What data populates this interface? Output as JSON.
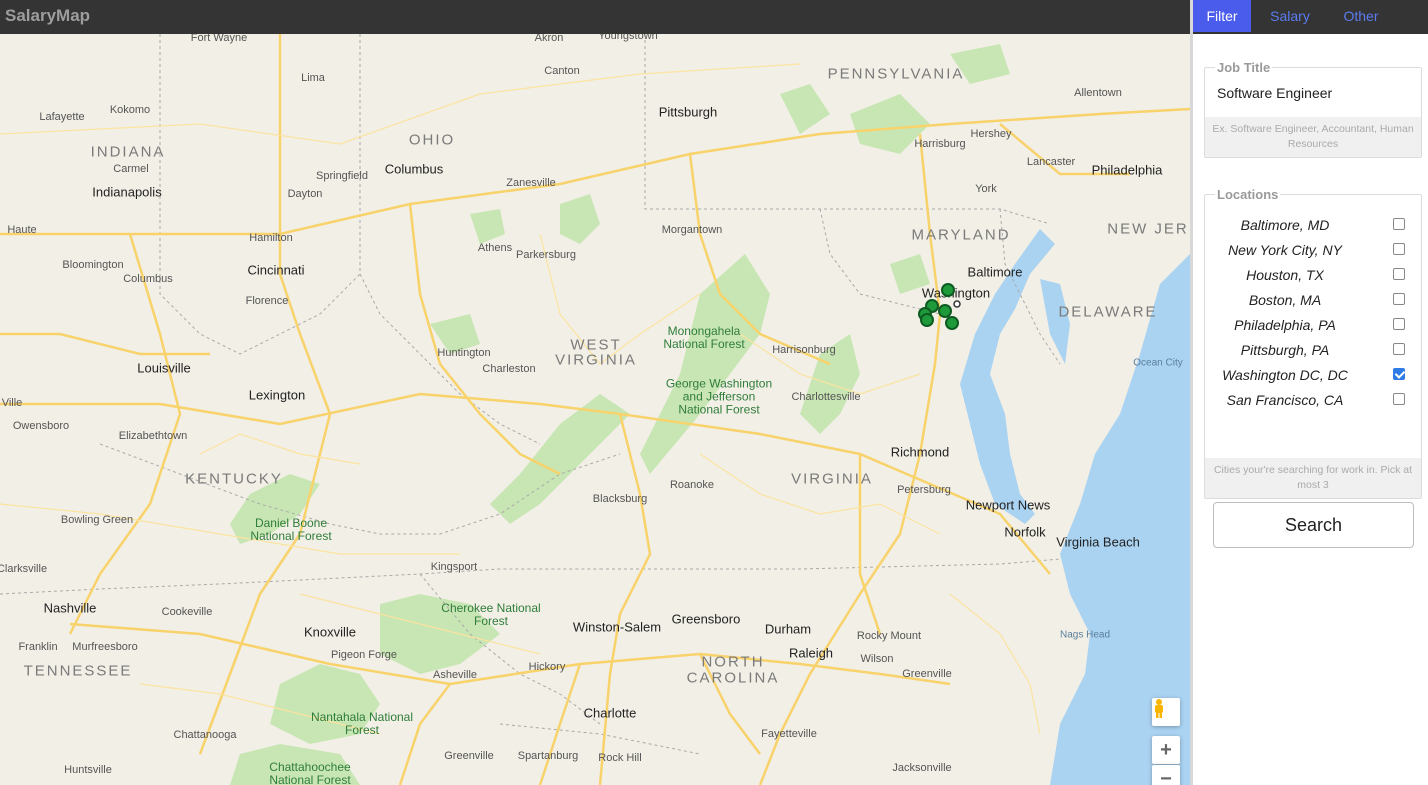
{
  "app": {
    "brand": "SalaryMap"
  },
  "tabs": [
    {
      "label": "Filter",
      "active": true
    },
    {
      "label": "Salary",
      "active": false
    },
    {
      "label": "Other",
      "active": false
    }
  ],
  "job_title": {
    "legend": "Job Title",
    "value": "Software Engineer",
    "help": "Ex. Software Engineer, Accountant, Human Resources"
  },
  "locations": {
    "legend": "Locations",
    "items": [
      {
        "label": "Baltimore, MD",
        "checked": false
      },
      {
        "label": "New York City, NY",
        "checked": false
      },
      {
        "label": "Houston, TX",
        "checked": false
      },
      {
        "label": "Boston, MA",
        "checked": false
      },
      {
        "label": "Philadelphia, PA",
        "checked": false
      },
      {
        "label": "Pittsburgh, PA",
        "checked": false
      },
      {
        "label": "Washington DC, DC",
        "checked": true
      },
      {
        "label": "San Francisco, CA",
        "checked": false
      }
    ],
    "help": "Cities your're searching for work in. Pick at most 3"
  },
  "search_button": "Search",
  "map": {
    "states": [
      "PENNSYLVANIA",
      "OHIO",
      "INDIANA",
      "WEST",
      "VIRGINIA",
      "MARYLAND",
      "NEW JER",
      "DELAWARE",
      "KENTUCKY",
      "VIRGINIA",
      "TENNESSEE",
      "NORTH",
      "CAROLINA"
    ],
    "cities": [
      "Fort Wayne",
      "Akron",
      "Youngstown",
      "Pittsburgh",
      "Allentown",
      "Lima",
      "Canton",
      "Lafayette",
      "Kokomo",
      "Columbus",
      "Harrisburg",
      "Hershey",
      "Philadelphia",
      "Carmel",
      "Indianapolis",
      "Dayton",
      "Springfield",
      "Zanesville",
      "Lancaster",
      "York",
      "Haute",
      "Hamilton",
      "Morgantown",
      "Athens",
      "Parkersburg",
      "Cincinnati",
      "Bloomington",
      "Columbus",
      "Florence",
      "Baltimore",
      "Washington",
      "Monongahela National Forest",
      "Huntington",
      "Charleston",
      "Harrisonburg",
      "Louisville",
      "Lexington",
      "George Washington and Jefferson National Forest",
      "Ocean City",
      "Owensboro",
      "Elizabethtown",
      "Charlottesville",
      "Richmond",
      "Petersburg",
      "Roanoke",
      "Newport News",
      "Norfolk",
      "Virginia Beach",
      "Bowling Green",
      "Daniel Boone National Forest",
      "Blacksburg",
      "Kingsport",
      "Nashville",
      "Cookeville",
      "Cherokee National Forest",
      "Knoxville",
      "Winston-Salem",
      "Greensboro",
      "Durham",
      "Rocky Mount",
      "Raleigh",
      "Nags Head",
      "Wilson",
      "Franklin",
      "Murfreesboro",
      "Pigeon Forge",
      "Hickory",
      "Greenville",
      "Asheville",
      "Charlotte",
      "Fayetteville",
      "Nantahala National Forest",
      "Chattanooga",
      "Chattahoochee National Forest",
      "Greenville",
      "Spartanburg",
      "Rock Hill",
      "Jacksonville",
      "Huntsville",
      "Clarksville",
      "Ville"
    ],
    "markers_color": "#1f9a3a",
    "zoom_in": "+",
    "zoom_out": "−"
  },
  "colors": {
    "topbar": "#343434",
    "brand": "#9d9d9d",
    "tab_active_bg": "#4a5cec",
    "tab_text": "#5b7cf0",
    "checkbox_checked": "#2f7ce6",
    "water": "#aad3f2",
    "land": "#f2efe6",
    "forest": "#c8e6b4",
    "road": "#f8d26a"
  }
}
